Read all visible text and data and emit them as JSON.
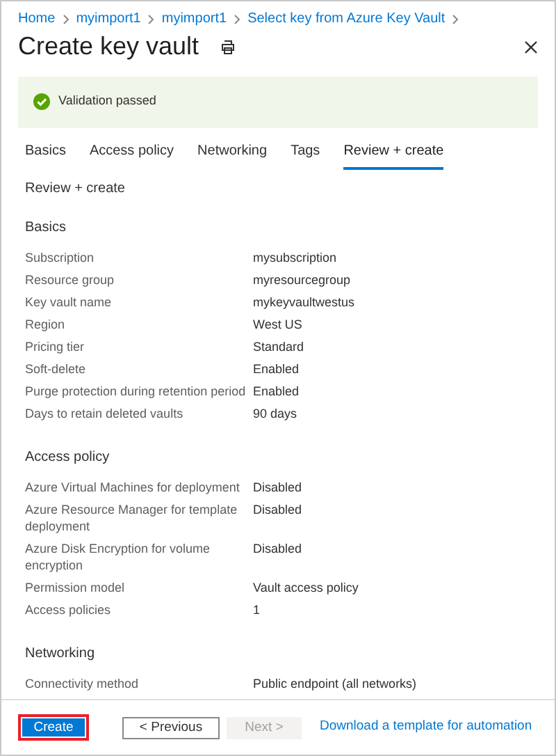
{
  "breadcrumb": [
    "Home",
    "myimport1",
    "myimport1",
    "Select key from Azure Key Vault"
  ],
  "title": "Create key vault",
  "banner": {
    "text": "Validation passed"
  },
  "tabs": [
    {
      "label": "Basics",
      "selected": false
    },
    {
      "label": "Access policy",
      "selected": false
    },
    {
      "label": "Networking",
      "selected": false
    },
    {
      "label": "Tags",
      "selected": false
    },
    {
      "label": "Review + create",
      "selected": true
    }
  ],
  "page_heading": "Review + create",
  "sections": [
    {
      "title": "Basics",
      "rows": [
        {
          "label": "Subscription",
          "value": "mysubscription"
        },
        {
          "label": "Resource group",
          "value": "myresourcegroup"
        },
        {
          "label": "Key vault name",
          "value": "mykeyvaultwestus"
        },
        {
          "label": "Region",
          "value": "West US"
        },
        {
          "label": "Pricing tier",
          "value": "Standard"
        },
        {
          "label": "Soft-delete",
          "value": "Enabled"
        },
        {
          "label": "Purge protection during retention period",
          "value": "Enabled"
        },
        {
          "label": "Days to retain deleted vaults",
          "value": "90 days"
        }
      ]
    },
    {
      "title": "Access policy",
      "rows": [
        {
          "label": "Azure Virtual Machines for deployment",
          "value": "Disabled"
        },
        {
          "label": "Azure Resource Manager for template deployment",
          "value": "Disabled"
        },
        {
          "label": "Azure Disk Encryption for volume encryption",
          "value": "Disabled"
        },
        {
          "label": "Permission model",
          "value": "Vault access policy"
        },
        {
          "label": "Access policies",
          "value": "1"
        }
      ]
    },
    {
      "title": "Networking",
      "rows": [
        {
          "label": "Connectivity method",
          "value": "Public endpoint (all networks)"
        }
      ]
    }
  ],
  "footer": {
    "buttons": [
      {
        "label": "Create",
        "kind": "primary",
        "highlighted": true,
        "disabled": false
      },
      {
        "label": "< Previous",
        "kind": "secondary",
        "highlighted": false,
        "disabled": false
      },
      {
        "label": "Next >",
        "kind": "secondary",
        "highlighted": false,
        "disabled": true
      }
    ],
    "link": "Download a template for automation"
  }
}
